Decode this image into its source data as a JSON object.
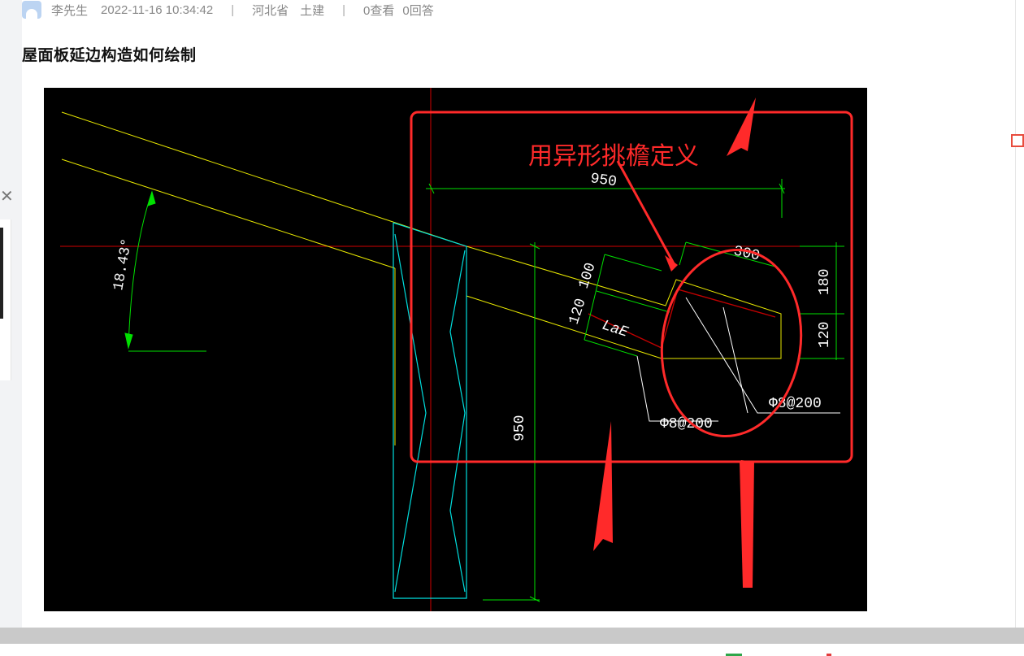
{
  "meta": {
    "author": "李先生",
    "datetime": "2022-11-16 10:34:42",
    "separator": "|",
    "province": "河北省",
    "major": "土建",
    "views": "0查看",
    "answers": "0回答"
  },
  "question": {
    "title": "屋面板延边构造如何绘制"
  },
  "drawing": {
    "annotation": "用异形挑檐定义",
    "angle_label": "18.43°",
    "dim_top": "950",
    "dim_vertical": "950",
    "dim_300": "300",
    "dim_180": "180",
    "dim_120_right": "120",
    "dim_100": "100",
    "dim_120_left": "120",
    "lae_label": "LaE",
    "rebar_left": "Φ8@200",
    "rebar_right": "Φ8@200"
  },
  "colors": {
    "annotation_red": "#ff2a2a",
    "cad_yellow": "#e8e800",
    "cad_green": "#00e000",
    "cad_cyan": "#00dede",
    "cad_red_line": "#d00000"
  },
  "icons": {
    "avatar": "user-avatar-icon",
    "close": "close-icon"
  }
}
